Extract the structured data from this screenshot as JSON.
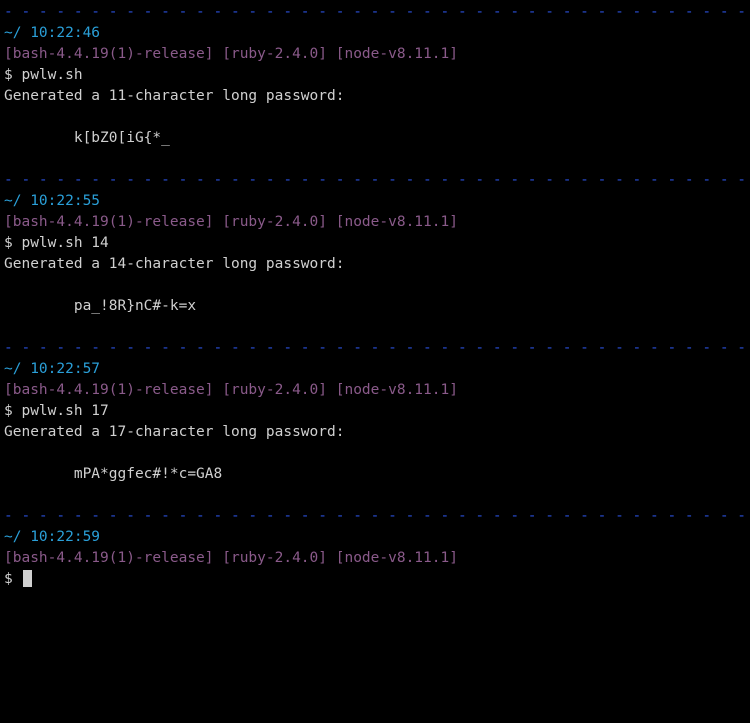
{
  "divider": "- - - - - - - - - - - - - - - - - - - - - - - - - - - - - - - - - - - - - - - - - - -",
  "blocks": [
    {
      "path_time": "~/  10:22:46",
      "env": "[bash-4.4.19(1)-release] [ruby-2.4.0] [node-v8.11.1]",
      "prompt": "$ ",
      "command": "pwlw.sh",
      "output": "Generated a 11-character long password:",
      "password": "        k[bZ0[iG{*_"
    },
    {
      "path_time": "~/  10:22:55",
      "env": "[bash-4.4.19(1)-release] [ruby-2.4.0] [node-v8.11.1]",
      "prompt": "$ ",
      "command": "pwlw.sh 14",
      "output": "Generated a 14-character long password:",
      "password": "        pa_!8R}nC#-k=x"
    },
    {
      "path_time": "~/  10:22:57",
      "env": "[bash-4.4.19(1)-release] [ruby-2.4.0] [node-v8.11.1]",
      "prompt": "$ ",
      "command": "pwlw.sh 17",
      "output": "Generated a 17-character long password:",
      "password": "        mPA*ggfec#!*c=GA8"
    }
  ],
  "final": {
    "path_time": "~/  10:22:59",
    "env": "[bash-4.4.19(1)-release] [ruby-2.4.0] [node-v8.11.1]",
    "prompt": "$ "
  }
}
